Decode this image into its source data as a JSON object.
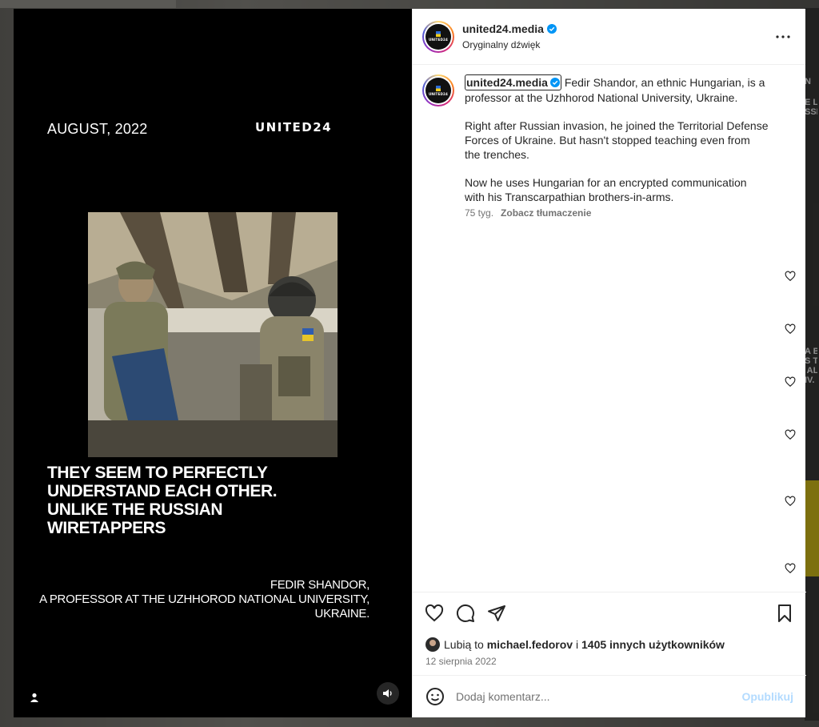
{
  "post_media": {
    "date": "AUGUST, 2022",
    "brand": "UNITED24",
    "headline": "THEY SEEM TO PERFECTLY UNDERSTAND EACH OTHER. UNLIKE THE RUSSIAN WIRETAPPERS",
    "caption_line1": "FEDIR SHANDOR,",
    "caption_line2": "A PROFESSOR AT THE UZHHOROD NATIONAL UNIVERSITY,",
    "caption_line3": "UKRAINE."
  },
  "header": {
    "username": "united24.media",
    "subtitle": "Oryginalny dźwięk",
    "avatar_text": "UNITED24"
  },
  "caption": {
    "owner": "united24.media",
    "p1": "Fedir Shandor, an ethnic Hungarian, is a professor at the Uzhhorod National University, Ukraine.",
    "p2": "Right after Russian invasion, he joined the Territorial Defense Forces of Ukraine. But hasn't stopped teaching even from the trenches.",
    "p3": "Now he uses Hungarian for an encrypted communication with his Transcarpathian brothers-in-arms.",
    "age": "75 tyg.",
    "translate": "Zobacz tłumaczenie"
  },
  "likes": {
    "prefix": "Lubią to",
    "user": "michael.fedorov",
    "middle": "i",
    "others": "1405 innych użytkowników"
  },
  "post_date": "12 sierpnia 2022",
  "comment": {
    "placeholder": "Dodaj komentarz...",
    "post_label": "Opublikuj"
  },
  "background_text": {
    "t1": "N",
    "t2": "E L\nSSI",
    "t3": "A B\nS T\n AL\nIV."
  },
  "colors": {
    "verified": "#0095f6",
    "post_button": "#b3dbff"
  }
}
